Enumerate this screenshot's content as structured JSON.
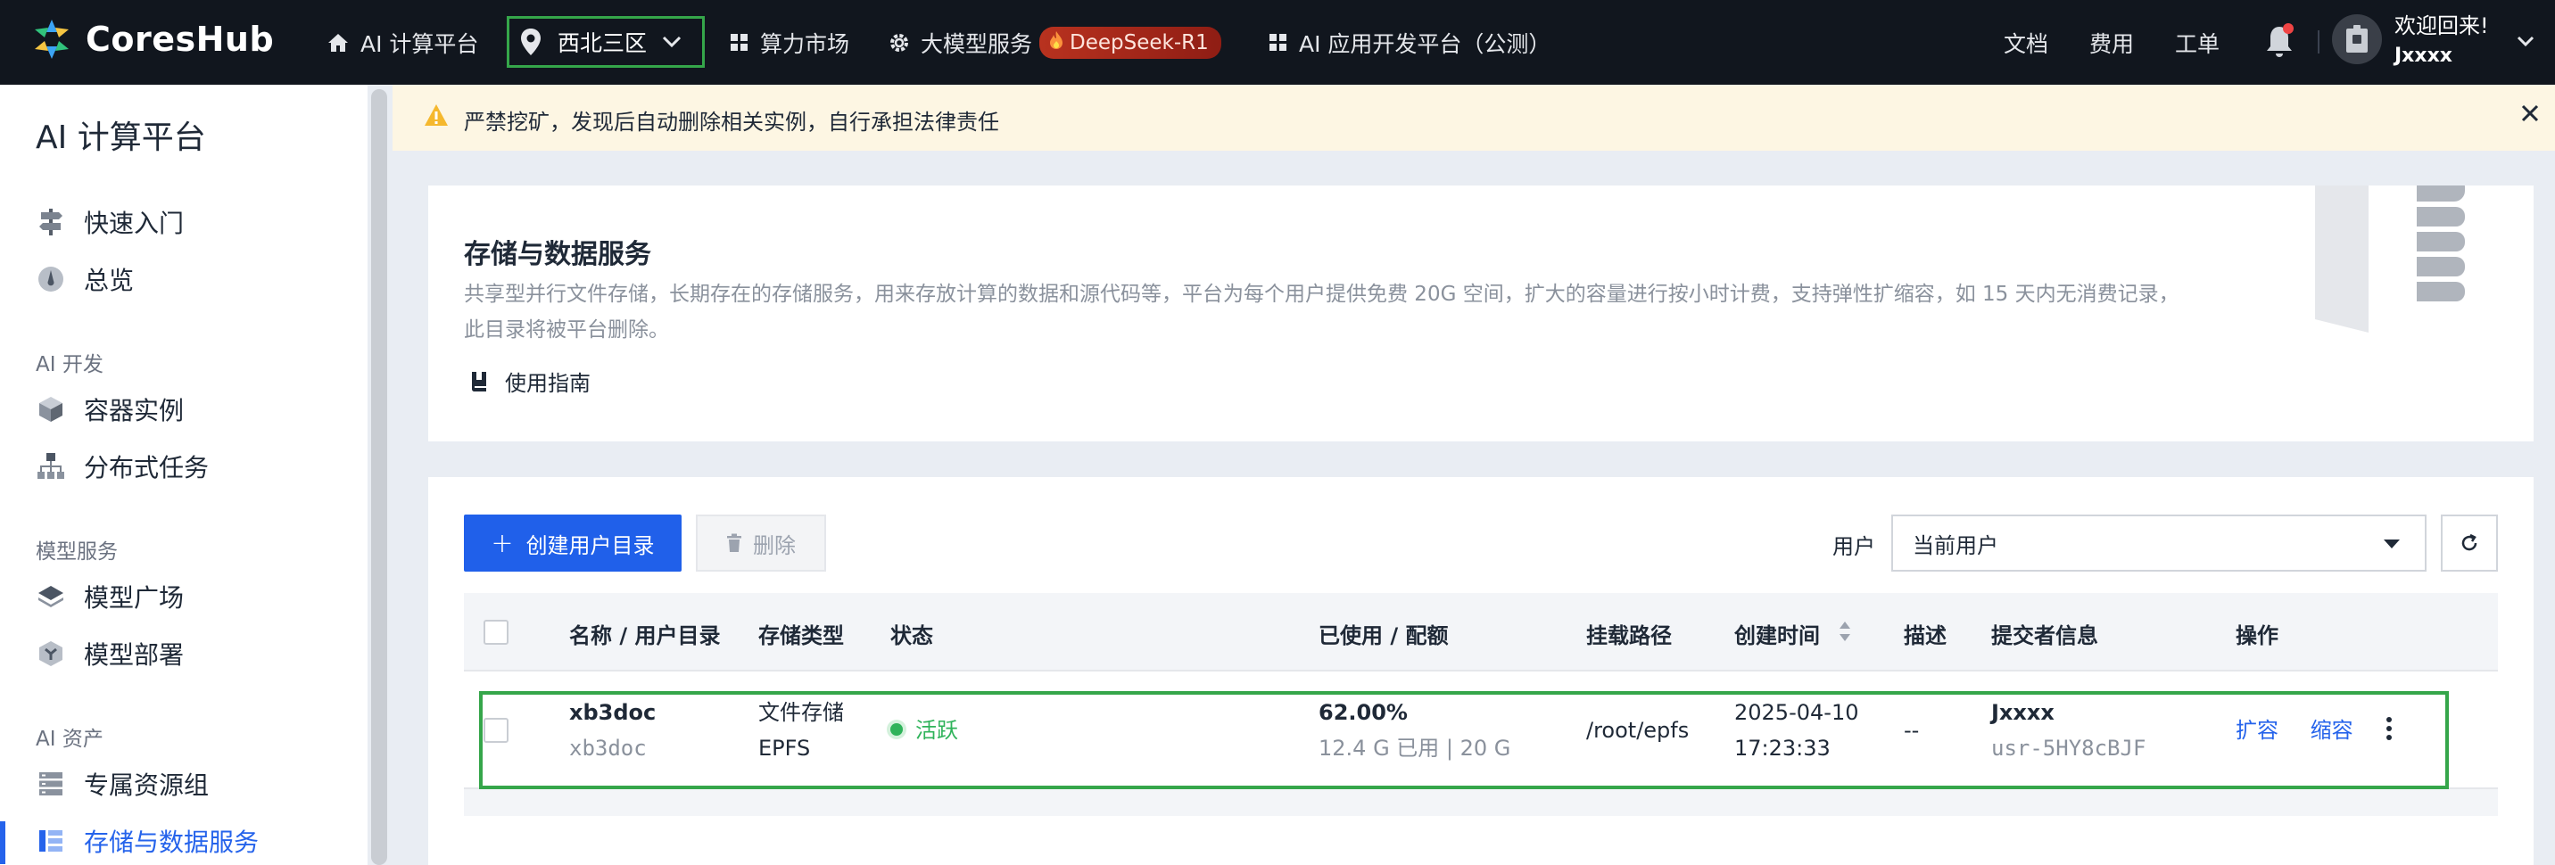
{
  "topnav": {
    "brand": "CoresHub",
    "items": [
      {
        "label": "AI 计算平台",
        "icon": "home-icon"
      },
      {
        "label": "算力市场",
        "icon": "grid-icon"
      },
      {
        "label": "大模型服务",
        "icon": "gear-icon"
      },
      {
        "label": "AI 应用开发平台（公测）",
        "icon": "grid-icon"
      }
    ],
    "region": "西北三区",
    "deepseek_badge": "DeepSeek-R1",
    "right": {
      "docs": "文档",
      "billing": "费用",
      "tickets": "工单"
    },
    "welcome": "欢迎回来!",
    "username": "Jxxxx"
  },
  "sidebar": {
    "title": "AI 计算平台",
    "items": [
      {
        "label": "快速入门",
        "icon": "signpost-icon"
      },
      {
        "label": "总览",
        "icon": "gauge-icon"
      }
    ],
    "groups": [
      {
        "label": "AI 开发",
        "items": [
          {
            "label": "容器实例",
            "icon": "cube-icon"
          },
          {
            "label": "分布式任务",
            "icon": "hierarchy-icon"
          }
        ]
      },
      {
        "label": "模型服务",
        "items": [
          {
            "label": "模型广场",
            "icon": "layers-icon"
          },
          {
            "label": "模型部署",
            "icon": "hexagon-icon"
          }
        ]
      },
      {
        "label": "AI 资产",
        "items": [
          {
            "label": "专属资源组",
            "icon": "server-icon"
          },
          {
            "label": "存储与数据服务",
            "icon": "storage-icon"
          }
        ]
      }
    ]
  },
  "banner": {
    "text": "严禁挖矿，发现后自动删除相关实例，自行承担法律责任"
  },
  "info": {
    "title": "存储与数据服务",
    "desc_line1": "共享型并行文件存储，长期存在的存储服务，用来存放计算的数据和源代码等，平台为每个用户提供免费 20G 空间，扩大的容量进行按小时计费，支持弹性扩缩容，如 15 天内无消费记录，",
    "desc_line2": "此目录将被平台删除。",
    "guide": "使用指南"
  },
  "toolbar": {
    "create": "创建用户目录",
    "delete": "删除",
    "user_label": "用户",
    "user_select": "当前用户"
  },
  "table": {
    "headers": [
      "名称 / 用户目录",
      "存储类型",
      "状态",
      "已使用 / 配额",
      "挂载路径",
      "创建时间",
      "描述",
      "提交者信息",
      "操作"
    ],
    "rows": [
      {
        "name": "xb3doc",
        "dir": "xb3doc",
        "type1": "文件存储",
        "type2": "EPFS",
        "status": "活跃",
        "usage_pct": "62.00%",
        "usage_detail": "12.4 G 已用 | 20 G",
        "mount": "/root/epfs",
        "date": "2025-04-10",
        "time": "17:23:33",
        "desc": "--",
        "submitter": "Jxxxx",
        "submitter_id": "usr-5HY8cBJF",
        "action_expand": "扩容",
        "action_shrink": "缩容"
      }
    ]
  },
  "colors": {
    "accent": "#2060ea",
    "nav_bg": "#11161e",
    "active_green": "#2fb35a",
    "highlight": "#35a64a"
  }
}
